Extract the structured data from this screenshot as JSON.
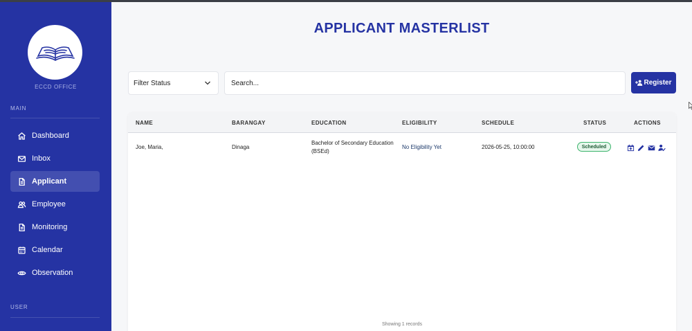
{
  "sidebar": {
    "office_name": "ECCD OFFICE",
    "section_main": "MAIN",
    "section_user": "USER",
    "items": [
      {
        "label": "Dashboard",
        "icon": "home-icon"
      },
      {
        "label": "Inbox",
        "icon": "mail-icon"
      },
      {
        "label": "Applicant",
        "icon": "document-icon",
        "active": true
      },
      {
        "label": "Employee",
        "icon": "users-icon"
      },
      {
        "label": "Monitoring",
        "icon": "document-icon"
      },
      {
        "label": "Calendar",
        "icon": "calendar-icon"
      },
      {
        "label": "Observation",
        "icon": "eye-icon"
      }
    ]
  },
  "header": {
    "title": "APPLICANT MASTERLIST"
  },
  "filters": {
    "status_select": "Filter Status",
    "search_placeholder": "Search...",
    "register_label": "Register"
  },
  "table": {
    "columns": [
      "NAME",
      "BARANGAY",
      "EDUCATION",
      "ELIGIBILITY",
      "SCHEDULE",
      "STATUS",
      "ACTIONS"
    ],
    "rows": [
      {
        "name": "Joe, Maria,",
        "barangay": "Dinaga",
        "education_line1": "Bachelor of Secondary Education",
        "education_line2": "(BSEd)",
        "eligibility": "No Eligibility Yet",
        "schedule": "2026-05-25, 10:00:00",
        "status": "Scheduled",
        "actions": [
          "calendar-add-icon",
          "edit-icon",
          "mail-icon",
          "user-check-icon"
        ]
      }
    ],
    "footer": "Showing 1 records"
  },
  "colors": {
    "sidebar_bg": "#2533a3",
    "accent": "#2533a3",
    "status_scheduled": "#3bb36b"
  }
}
